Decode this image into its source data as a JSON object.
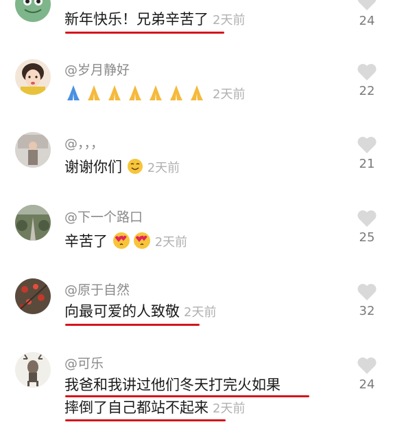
{
  "comments": [
    {
      "username": "",
      "text_lines": [
        "新年快乐！兄弟辛苦了"
      ],
      "time": "2天前",
      "likes": "24",
      "avatar_icon": "frog-avatar-icon"
    },
    {
      "username": "@岁月静好",
      "text_lines": [
        ""
      ],
      "emoji": "pray-hands-emoji x7",
      "time": "2天前",
      "likes": "22",
      "avatar_icon": "girl-avatar-icon"
    },
    {
      "username": "@，，，",
      "text_lines": [
        "谢谢你们"
      ],
      "emoji": "smiling-face-emoji",
      "time": "2天前",
      "likes": "21",
      "avatar_icon": "person-avatar-icon"
    },
    {
      "username": "@下一个路口",
      "text_lines": [
        "辛苦了"
      ],
      "emoji": "heart-eyes-kiss-emoji x2",
      "time": "2天前",
      "likes": "25",
      "avatar_icon": "road-avatar-icon"
    },
    {
      "username": "@原于自然",
      "text_lines": [
        "向最可爱的人致敬"
      ],
      "time": "2天前",
      "likes": "32",
      "avatar_icon": "berries-avatar-icon"
    },
    {
      "username": "@可乐",
      "text_lines": [
        "我爸和我讲过他们冬天打完火如果",
        "摔倒了自己都站不起来"
      ],
      "time": "2天前",
      "likes": "24",
      "avatar_icon": "deer-avatar-icon"
    }
  ],
  "colors": {
    "underline": "#d4141b",
    "username": "#8a8a8a",
    "time": "#b0b0b0",
    "heart": "#d9d9d9"
  }
}
